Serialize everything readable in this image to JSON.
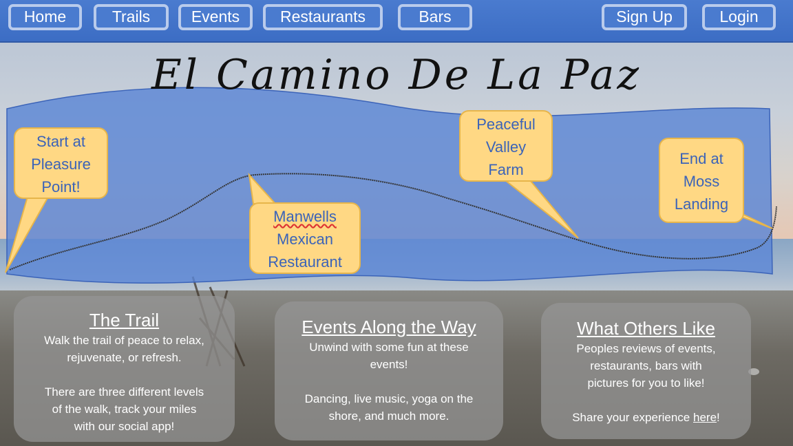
{
  "nav": {
    "left": [
      "Home",
      "Trails",
      "Events",
      "Restaurants",
      "Bars"
    ],
    "right": [
      "Sign Up",
      "Login"
    ]
  },
  "hero": {
    "title": "El Camino De La Paz"
  },
  "callouts": {
    "start": [
      "Start at",
      "Pleasure",
      "Point!"
    ],
    "manwells": [
      "Manwells",
      "Mexican",
      "Restaurant"
    ],
    "farm": [
      "Peaceful",
      "Valley",
      "Farm"
    ],
    "end": [
      "End at",
      "Moss",
      "Landing"
    ]
  },
  "cards": {
    "trail": {
      "title": "The Trail",
      "lines1": [
        "Walk the trail of peace to relax,",
        "rejuvenate, or refresh."
      ],
      "lines2": [
        "There are three different levels",
        "of the walk, track your miles",
        "with our social app!"
      ]
    },
    "events": {
      "title": "Events Along the Way",
      "lines1": [
        "Unwind with some fun at these",
        "events!"
      ],
      "lines2": [
        "Dancing, live music, yoga on the",
        "shore, and much more."
      ]
    },
    "others": {
      "title": "What Others Like",
      "lines1": [
        "Peoples reviews of events,",
        "restaurants, bars with",
        "pictures for you to like!"
      ],
      "share_prefix": "Share your experience ",
      "share_link": "here",
      "share_suffix": "!"
    }
  },
  "colors": {
    "nav": "#4a7bcf",
    "banner": "#5b86d6",
    "callout_fill": "#ffd884",
    "callout_text": "#3b63b8"
  }
}
